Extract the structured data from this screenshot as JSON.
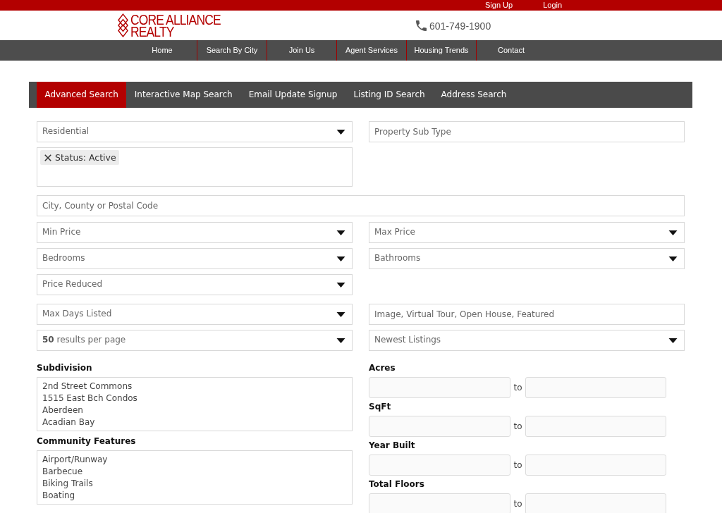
{
  "top_bar": {
    "links": [
      "Sign Up",
      "Login"
    ]
  },
  "header": {
    "logo_lines": [
      "CORE ALLIANCE",
      "REALTY"
    ],
    "phone": "601-749-1900"
  },
  "nav": {
    "items": [
      "Home",
      "Search By City",
      "Join Us",
      "Agent Services",
      "Housing Trends",
      "Contact"
    ]
  },
  "search_tabs": [
    {
      "label": "Advanced Search",
      "selected": true
    },
    {
      "label": "Interactive Map Search",
      "selected": false
    },
    {
      "label": "Email Update Signup",
      "selected": false
    },
    {
      "label": "Listing ID Search",
      "selected": false
    },
    {
      "label": "Address Search",
      "selected": false
    }
  ],
  "form": {
    "top_row": [
      {
        "kind": "select",
        "value": "Residential"
      },
      {
        "kind": "input",
        "placeholder": "Property Sub Type"
      }
    ],
    "status_tags": [
      {
        "label": "Status: Active"
      }
    ],
    "location": {
      "placeholder": "City, County or Postal Code"
    },
    "filter_groups": [
      {
        "rows": [
          {
            "cells": [
              {
                "kind": "select",
                "value": "Min Price"
              },
              {
                "kind": "select",
                "value": "Max Price"
              }
            ]
          },
          {
            "cells": [
              {
                "kind": "select",
                "value": "Bedrooms"
              },
              {
                "kind": "select",
                "value": "Bathrooms"
              }
            ]
          },
          {
            "cells": [
              {
                "kind": "select",
                "value": "Price Reduced"
              }
            ]
          }
        ]
      },
      {
        "rows": [
          {
            "cells": [
              {
                "kind": "select",
                "value": "Max Days Listed"
              },
              {
                "kind": "input",
                "placeholder": "Image, Virtual Tour, Open House, Featured"
              }
            ]
          },
          {
            "cells": [
              {
                "kind": "select",
                "value": "**50** results per page"
              },
              {
                "kind": "select",
                "value": "Newest Listings"
              }
            ]
          }
        ]
      }
    ],
    "lists": [
      {
        "label": "Subdivision",
        "options": [
          {
            "label": "2nd Street Commons",
            "selected": false
          },
          {
            "label": "1515 East Bch Condos",
            "selected": false
          },
          {
            "label": "Aberdeen",
            "selected": false
          },
          {
            "label": "Acadian Bay",
            "selected": false
          }
        ]
      },
      {
        "label": "Community Features",
        "options": [
          {
            "label": "Airport/Runway",
            "selected": false
          },
          {
            "label": "Barbecue",
            "selected": false
          },
          {
            "label": "Biking Trails",
            "selected": false
          },
          {
            "label": "Boating",
            "selected": false
          }
        ]
      }
    ],
    "ranges": [
      {
        "label": "Acres",
        "separator": "to"
      },
      {
        "label": "SqFt",
        "separator": "to"
      },
      {
        "label": "Year Built",
        "separator": "to"
      },
      {
        "label": "Total Floors",
        "separator": "to"
      }
    ]
  }
}
